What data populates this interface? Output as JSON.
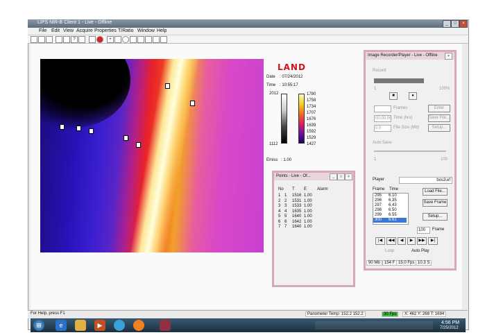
{
  "window": {
    "title": "LIPS NIR-B Client 1 - Live - Offline"
  },
  "menu": [
    "File",
    "Edit",
    "View",
    "Acquire",
    "Properties",
    "T/Ratio",
    "Window",
    "Help"
  ],
  "logo": "LAND",
  "readout": {
    "date_label": "Date",
    "date_value": ": 07/24/2012",
    "time_label": "Time",
    "time_value": ": 10:55:17",
    "scale_left_top": "2012",
    "scale_left_bottom": "1112",
    "scale_right": [
      "1780",
      "1758",
      "1734",
      "1707",
      "1676",
      "1639",
      "1592",
      "1529",
      "1427"
    ],
    "emiss_label": "Emiss",
    "emiss_value": ": 1.00"
  },
  "points_panel": {
    "title": "Points - Live - Of...",
    "headers": [
      "No",
      "T",
      "E",
      "Alarm"
    ],
    "rows": [
      {
        "no": "1",
        "t": "1516",
        "e": "1.00"
      },
      {
        "no": "2",
        "t": "1531",
        "e": "1.00"
      },
      {
        "no": "3",
        "t": "1533",
        "e": "1.00"
      },
      {
        "no": "4",
        "t": "1635",
        "e": "1.00"
      },
      {
        "no": "5",
        "t": "1640",
        "e": "1.00"
      },
      {
        "no": "6",
        "t": "1642",
        "e": "1.00"
      },
      {
        "no": "7",
        "t": "1640",
        "e": "1.00"
      }
    ]
  },
  "recorder": {
    "title": "Image Recorder/Player - Live - Offline",
    "record_label": "Record",
    "range_start": "1",
    "range_end": "100%",
    "frames_label": "Frames",
    "time_label": "Time (hrs)",
    "time_value": "00:00:00",
    "filesize_label": "File Size (Mb)",
    "filesize_value": "0.0",
    "enter": "Enter",
    "save_file": "Save File...",
    "setup": "Setup...",
    "autosave_label": "Auto Save",
    "slider_start": "1",
    "slider_end": "100",
    "player_label": "Player",
    "player_file": "bos3.ef",
    "frame_header": "Frame",
    "time_header": "Time",
    "frames": [
      {
        "f": "295",
        "t": "6.10"
      },
      {
        "f": "296",
        "t": "6.35"
      },
      {
        "f": "297",
        "t": "6.43"
      },
      {
        "f": "298",
        "t": "6.50"
      },
      {
        "f": "299",
        "t": "6.55"
      },
      {
        "f": "300",
        "t": "6.61"
      }
    ],
    "load_file": "Load File...",
    "save_frame": "Save Frame",
    "setup2": "Setup...",
    "frame_count": "100",
    "frame_count_label": "Frame",
    "loop_label": "Loop",
    "autoplay_label": "Auto Play",
    "status": [
      "90 Mb",
      "154 F",
      "15.0 Fps",
      "10.3 S"
    ]
  },
  "status": {
    "help": "For Help, press F1",
    "mid": "Panometer Temp: 152.2 152.2",
    "fps": "30 Fps",
    "coords": "X: 462   Y: 268   T: 1694"
  },
  "clock": {
    "time": "4:56 PM",
    "date": "7/25/2012"
  },
  "colors": {
    "accent_red": "#d0101a",
    "panel_border": "#d7a8b5"
  }
}
